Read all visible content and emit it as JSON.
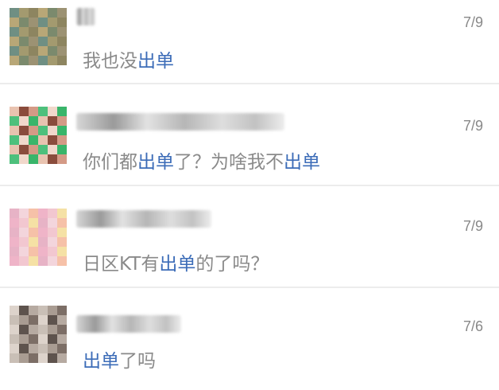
{
  "chats": [
    {
      "date": "7/9",
      "message": [
        {
          "text": "我也没"
        },
        {
          "text": "出单",
          "kw": true
        }
      ],
      "avatar_palette": [
        "#6f8f83",
        "#a39a6f",
        "#8d8560",
        "#b8a777",
        "#7b8a6d",
        "#9c9273"
      ]
    },
    {
      "date": "7/9",
      "message": [
        {
          "text": "你们都"
        },
        {
          "text": "出单",
          "kw": true
        },
        {
          "text": "了？为啥我不"
        },
        {
          "text": "出单",
          "kw": true
        }
      ],
      "avatar_palette": [
        "#39b56a",
        "#e9c3b0",
        "#8a4c3c",
        "#d49a86",
        "#4ec07c",
        "#f1d8cb"
      ]
    },
    {
      "date": "7/9",
      "message": [
        {
          "text": "日区KT有"
        },
        {
          "text": "出单",
          "kw": true
        },
        {
          "text": "的了吗？"
        }
      ],
      "avatar_palette": [
        "#f2c7d0",
        "#f5e1a5",
        "#e7b3c6",
        "#f3d5dc",
        "#f6c1a8",
        "#efb4c8"
      ]
    },
    {
      "date": "7/6",
      "message": [
        {
          "text": "出单",
          "kw": true
        },
        {
          "text": "了吗"
        }
      ],
      "avatar_palette": [
        "#c9bfb6",
        "#a99c92",
        "#7c6e66",
        "#ddd3cb",
        "#5e534d",
        "#b6aaa1"
      ]
    }
  ]
}
